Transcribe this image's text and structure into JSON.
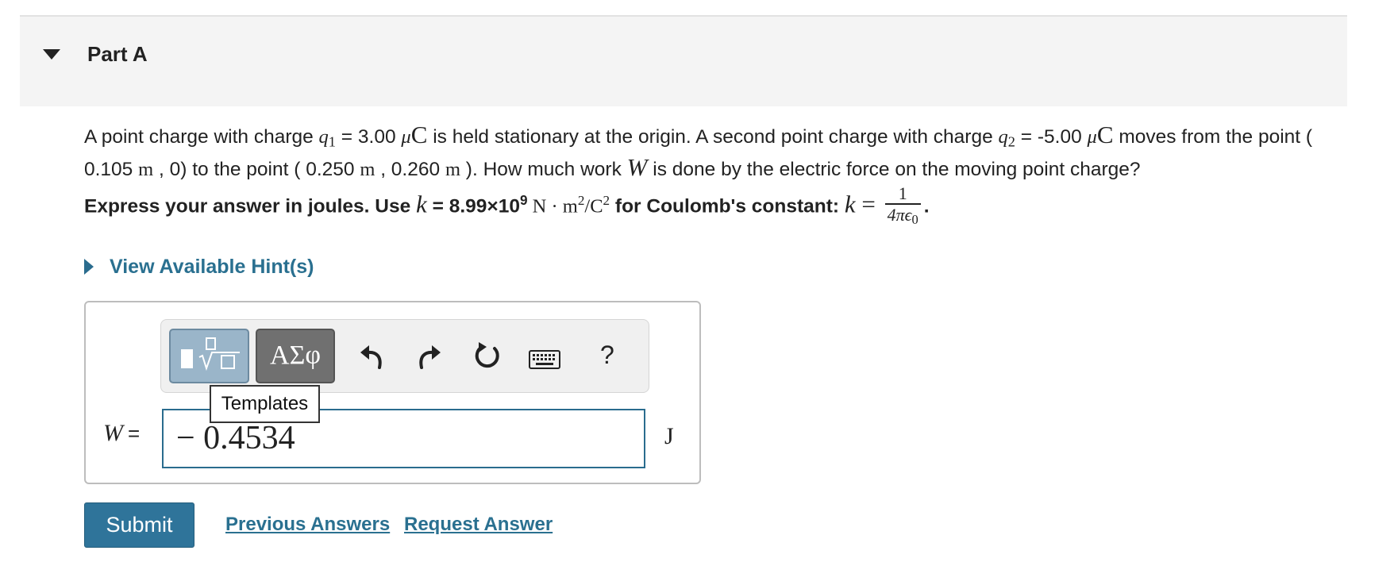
{
  "part": {
    "title": "Part A"
  },
  "problem": {
    "t1": "A point charge with charge ",
    "q1_var": "q",
    "q1_sub": "1",
    "t2": " = 3.00 ",
    "mu1": "μ",
    "c1": "C",
    "t3": " is held stationary at the origin. A second point charge with charge ",
    "q2_var": "q",
    "q2_sub": "2",
    "t4": " = -5.00 ",
    "mu2": "μ",
    "c2": "C",
    "t5": " moves from the point ( 0.105 ",
    "m1": "m",
    "t6": " , 0) to the point ( 0.250 ",
    "m2": "m",
    "t7": " , 0.260 ",
    "m3": "m",
    "t8": " ). How much work ",
    "w": "W",
    "t9": " is done by the electric force on the moving point charge?"
  },
  "instruction": {
    "t1": "Express your answer in joules. Use ",
    "k1": "k",
    "t2": " = 8.99×10",
    "exp": "9",
    "n": " N · m",
    "m_exp": "2",
    "slash": "/C",
    "c_exp": "2",
    "t3": " for Coulomb's constant: ",
    "k2": "k",
    "eq": " = ",
    "frac_num": "1",
    "frac_den_a": "4πϵ",
    "frac_den_sub": "0",
    "period": "."
  },
  "hint": {
    "label": "View Available Hint(s)"
  },
  "toolbar": {
    "greek_label": "ΑΣφ",
    "help_label": "?",
    "tooltip": "Templates"
  },
  "answer": {
    "var": "W",
    "eq": "=",
    "value": "− 0.4534",
    "unit": "J"
  },
  "actions": {
    "submit": "Submit",
    "previous": "Previous Answers",
    "request": "Request Answer"
  },
  "colors": {
    "accent": "#2a7090",
    "submit_bg": "#2f749a",
    "header_bg": "#f4f4f4"
  }
}
